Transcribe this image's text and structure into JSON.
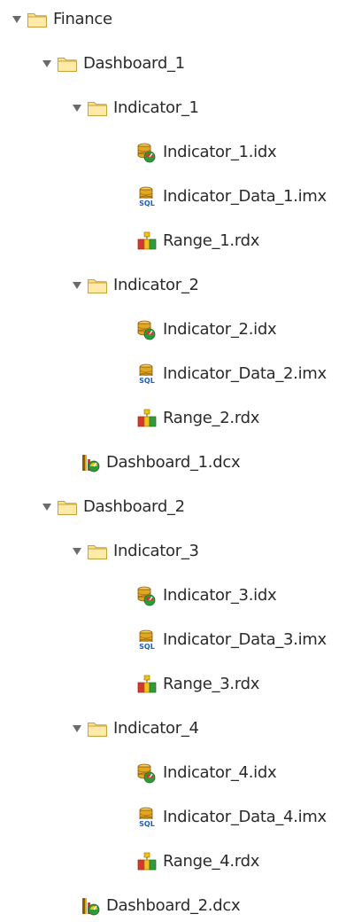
{
  "tree": {
    "rows": [
      {
        "label": "Finance",
        "depth": 0,
        "kind": "folder",
        "expanded": true
      },
      {
        "label": "Dashboard_1",
        "depth": 1,
        "kind": "folder",
        "expanded": true
      },
      {
        "label": "Indicator_1",
        "depth": 2,
        "kind": "folder",
        "expanded": true
      },
      {
        "label": "Indicator_1.idx",
        "depth": 3,
        "kind": "indicator"
      },
      {
        "label": "Indicator_Data_1.imx",
        "depth": 3,
        "kind": "sql"
      },
      {
        "label": "Range_1.rdx",
        "depth": 3,
        "kind": "range"
      },
      {
        "label": "Indicator_2",
        "depth": 2,
        "kind": "folder",
        "expanded": true
      },
      {
        "label": "Indicator_2.idx",
        "depth": 3,
        "kind": "indicator"
      },
      {
        "label": "Indicator_Data_2.imx",
        "depth": 3,
        "kind": "sql"
      },
      {
        "label": "Range_2.rdx",
        "depth": 3,
        "kind": "range"
      },
      {
        "label": "Dashboard_1.dcx",
        "depth": 2,
        "kind": "dashboard"
      },
      {
        "label": "Dashboard_2",
        "depth": 1,
        "kind": "folder",
        "expanded": true
      },
      {
        "label": "Indicator_3",
        "depth": 2,
        "kind": "folder",
        "expanded": true
      },
      {
        "label": "Indicator_3.idx",
        "depth": 3,
        "kind": "indicator"
      },
      {
        "label": "Indicator_Data_3.imx",
        "depth": 3,
        "kind": "sql"
      },
      {
        "label": "Range_3.rdx",
        "depth": 3,
        "kind": "range"
      },
      {
        "label": "Indicator_4",
        "depth": 2,
        "kind": "folder",
        "expanded": true
      },
      {
        "label": "Indicator_4.idx",
        "depth": 3,
        "kind": "indicator"
      },
      {
        "label": "Indicator_Data_4.imx",
        "depth": 3,
        "kind": "sql"
      },
      {
        "label": "Range_4.rdx",
        "depth": 3,
        "kind": "range"
      },
      {
        "label": "Dashboard_2.dcx",
        "depth": 2,
        "kind": "dashboard"
      }
    ],
    "icons": {
      "folder": "folder-icon",
      "indicator": "indicator-file-icon",
      "sql": "sql-database-icon",
      "range": "range-file-icon",
      "dashboard": "dashboard-file-icon",
      "toggle": "expand-triangle-icon"
    },
    "colors": {
      "text": "#2a2a2a",
      "folder_fill": "#fde08a",
      "folder_stroke": "#c9a23a",
      "toggle": "#6b6b6b",
      "db_gold": "#e0a820",
      "db_dark": "#8a5a10",
      "sql_blue": "#1f5fb8",
      "green": "#2f9a3a",
      "red": "#d23a2a",
      "yellow": "#f2c21a"
    }
  }
}
